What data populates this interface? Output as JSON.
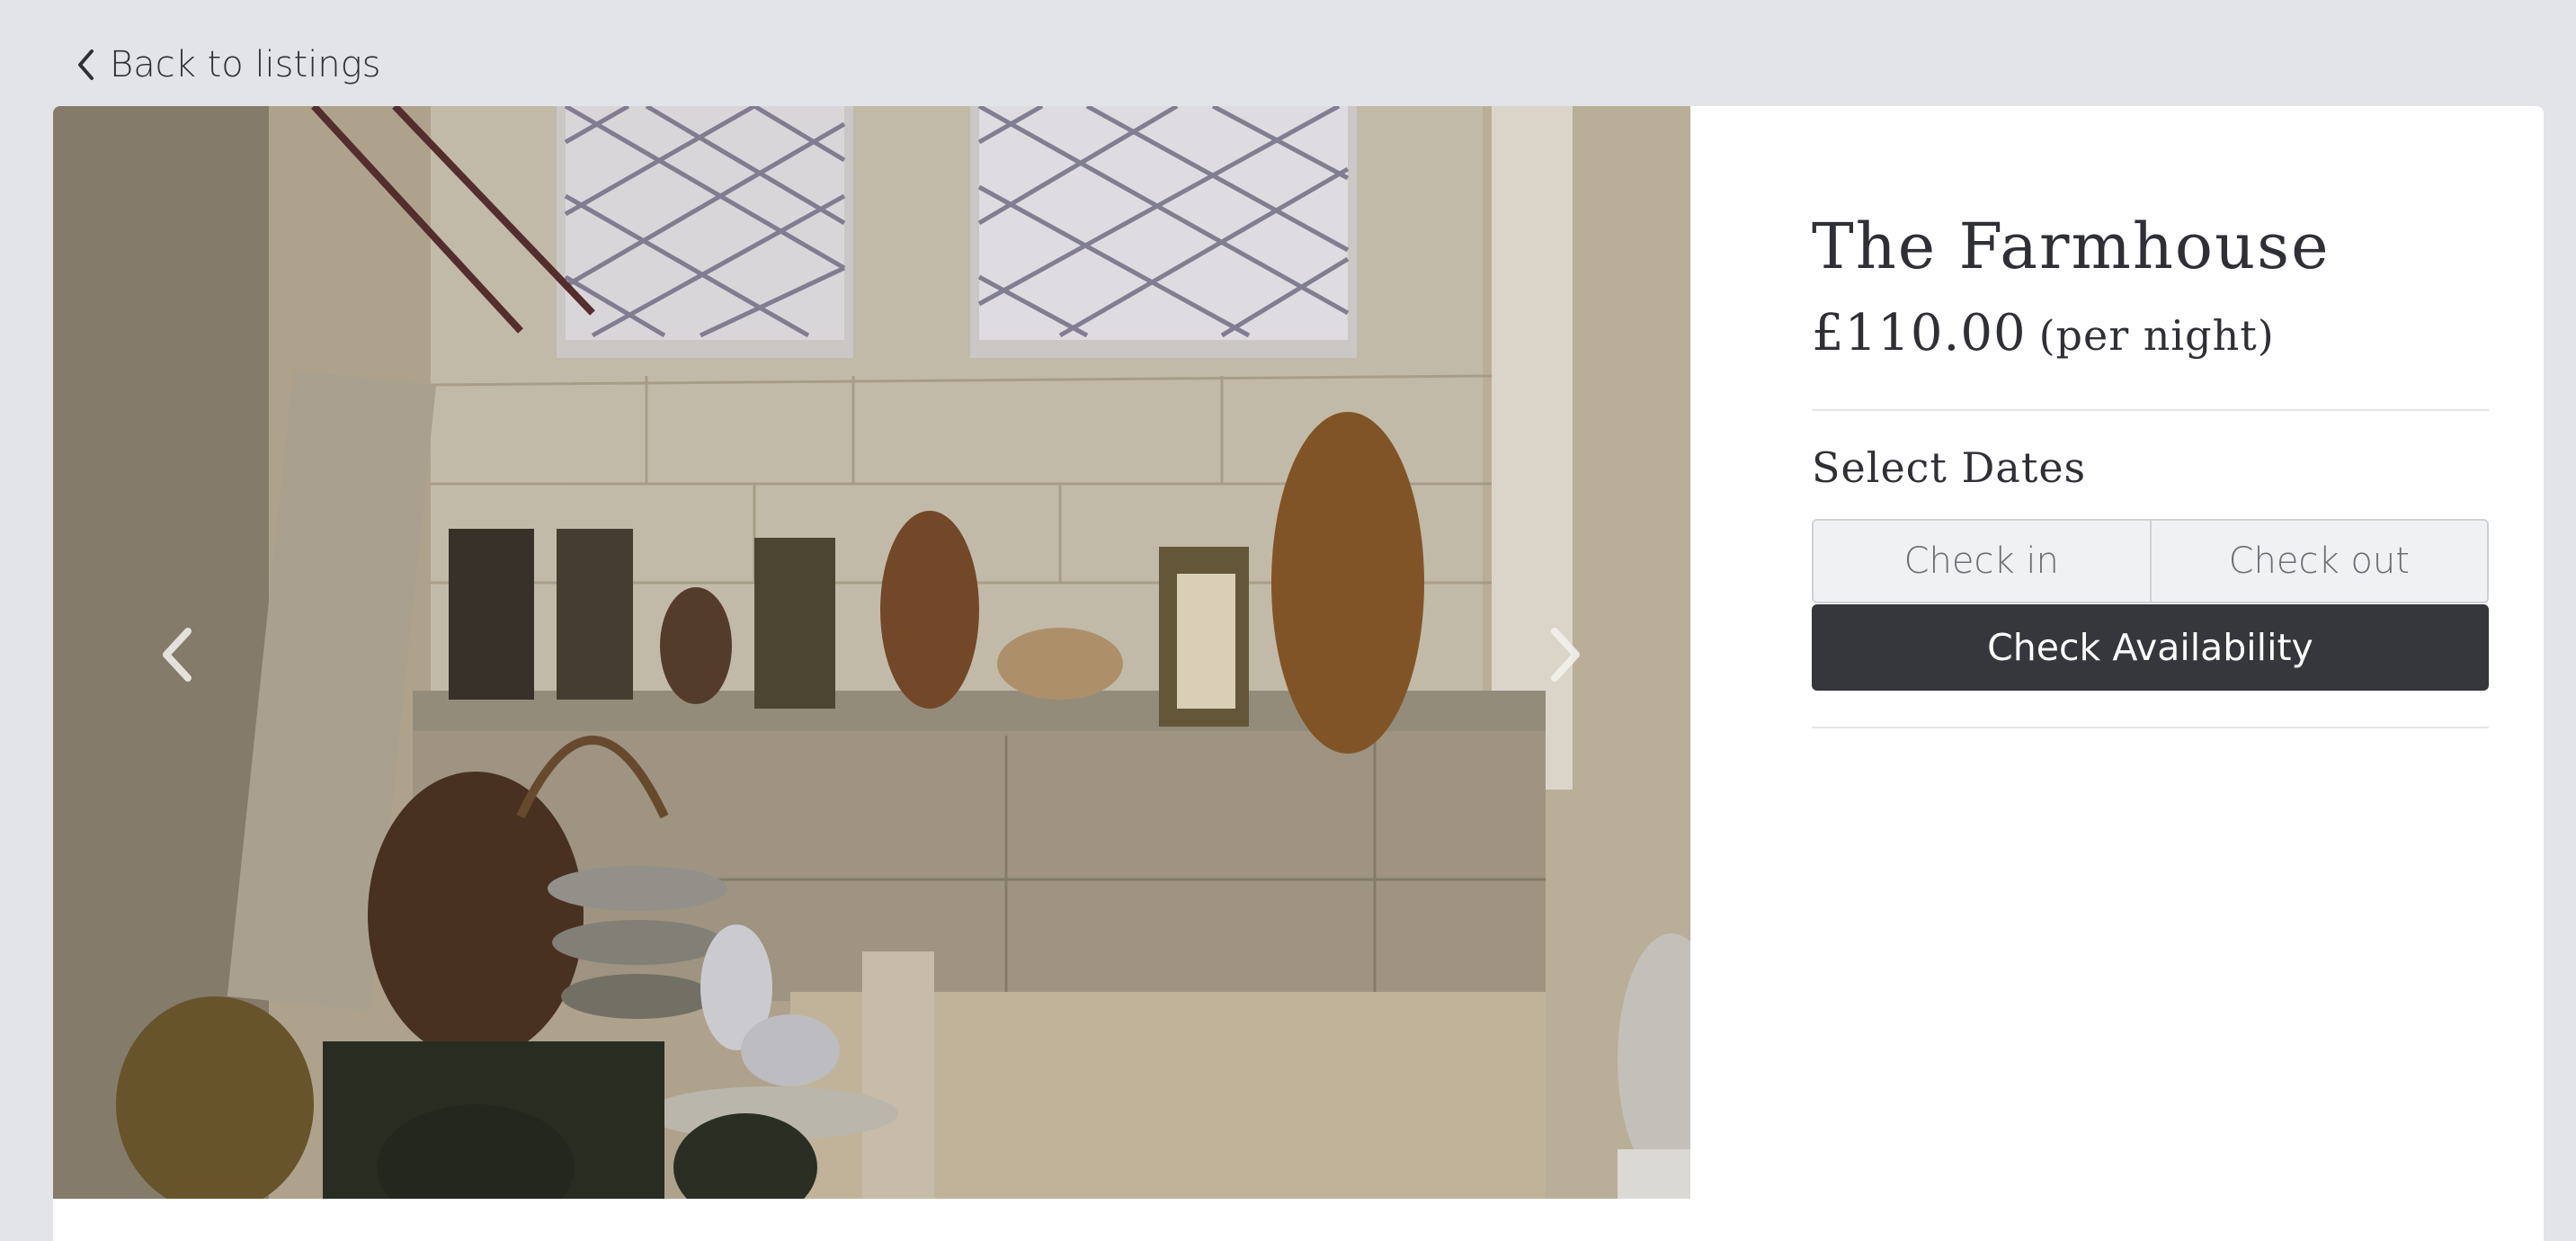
{
  "nav": {
    "back_label": "Back to listings"
  },
  "listing": {
    "title": "The Farmhouse",
    "price": "£110.00",
    "price_unit": "(per night)"
  },
  "booking": {
    "section_title": "Select Dates",
    "check_in_placeholder": "Check in",
    "check_out_placeholder": "Check out",
    "submit_label": "Check Availability"
  },
  "carousel": {
    "prev_icon": "chevron-left-icon",
    "next_icon": "chevron-right-icon"
  },
  "colors": {
    "page_background": "#e2e4e9",
    "card_background": "#ffffff",
    "button_background": "#36373c",
    "button_text": "#ffffff",
    "text": "#2f3036"
  }
}
